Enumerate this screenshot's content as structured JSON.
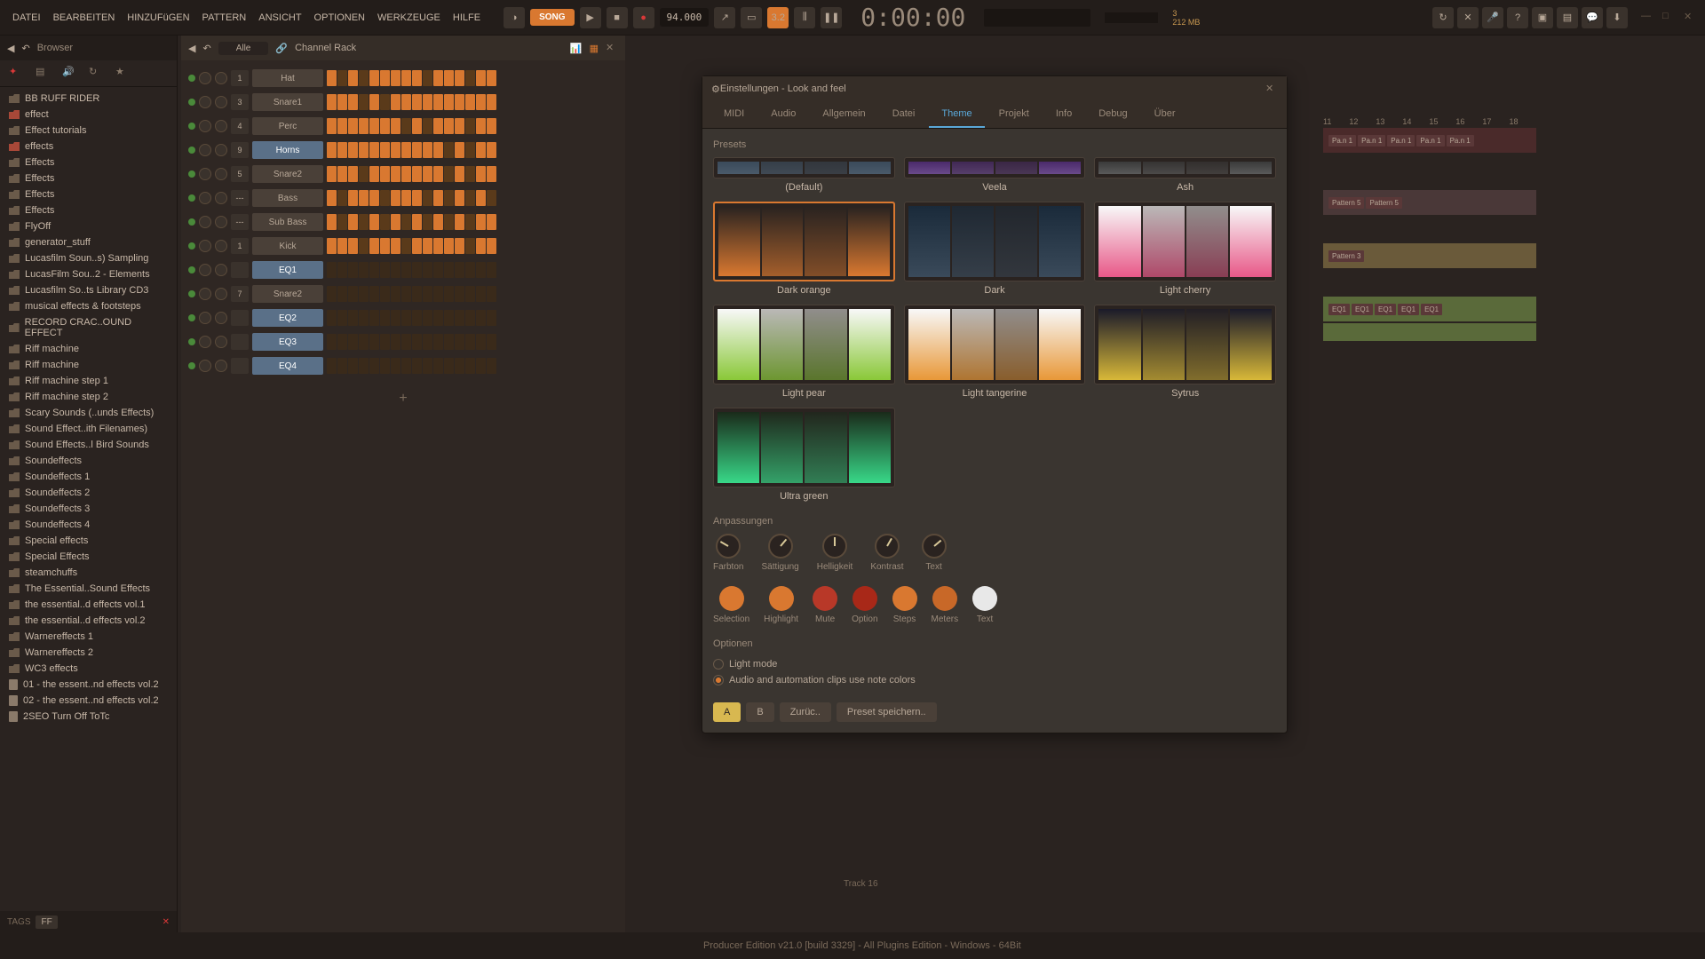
{
  "menubar": {
    "items": [
      "DATEI",
      "BEARBEITEN",
      "HINZUFüGEN",
      "PATTERN",
      "ANSICHT",
      "OPTIONEN",
      "WERKZEUGE",
      "HILFE"
    ]
  },
  "toolbar": {
    "song_label": "SONG",
    "bpm": "94.000",
    "time": "0:00:00",
    "cpu": "3",
    "mem": "212 MB"
  },
  "browser": {
    "title": "Browser",
    "items": [
      {
        "name": "BB RUFF RIDER",
        "type": "folder"
      },
      {
        "name": "effect",
        "type": "folder-red"
      },
      {
        "name": "Effect tutorials",
        "type": "folder"
      },
      {
        "name": "effects",
        "type": "folder-red"
      },
      {
        "name": "Effects",
        "type": "folder"
      },
      {
        "name": "Effects",
        "type": "folder"
      },
      {
        "name": "Effects",
        "type": "folder"
      },
      {
        "name": "Effects",
        "type": "folder"
      },
      {
        "name": "FlyOff",
        "type": "folder"
      },
      {
        "name": "generator_stuff",
        "type": "folder"
      },
      {
        "name": "Lucasfilm Soun..s) Sampling",
        "type": "folder"
      },
      {
        "name": "LucasFilm Sou..2 - Elements",
        "type": "folder"
      },
      {
        "name": "Lucasfilm So..ts Library CD3",
        "type": "folder"
      },
      {
        "name": "musical effects & footsteps",
        "type": "folder"
      },
      {
        "name": "RECORD CRAC..OUND EFFECT",
        "type": "folder"
      },
      {
        "name": "Riff machine",
        "type": "folder"
      },
      {
        "name": "Riff machine",
        "type": "folder"
      },
      {
        "name": "Riff machine step 1",
        "type": "folder"
      },
      {
        "name": "Riff machine step 2",
        "type": "folder"
      },
      {
        "name": "Scary Sounds (..unds Effects)",
        "type": "folder"
      },
      {
        "name": "Sound Effect..ith Filenames)",
        "type": "folder"
      },
      {
        "name": "Sound Effects..l Bird Sounds",
        "type": "folder"
      },
      {
        "name": "Soundeffects",
        "type": "folder"
      },
      {
        "name": "Soundeffects 1",
        "type": "folder"
      },
      {
        "name": "Soundeffects 2",
        "type": "folder"
      },
      {
        "name": "Soundeffects 3",
        "type": "folder"
      },
      {
        "name": "Soundeffects 4",
        "type": "folder"
      },
      {
        "name": "Special effects",
        "type": "folder"
      },
      {
        "name": "Special Effects",
        "type": "folder"
      },
      {
        "name": "steamchuffs",
        "type": "folder"
      },
      {
        "name": "The Essential..Sound Effects",
        "type": "folder"
      },
      {
        "name": "the essential..d effects vol.1",
        "type": "folder"
      },
      {
        "name": "the essential..d effects vol.2",
        "type": "folder"
      },
      {
        "name": "Warnereffects 1",
        "type": "folder"
      },
      {
        "name": "Warnereffects 2",
        "type": "folder"
      },
      {
        "name": "WC3 effects",
        "type": "folder"
      },
      {
        "name": "01 - the essent..nd effects vol.2",
        "type": "file"
      },
      {
        "name": "02 - the essent..nd effects vol.2",
        "type": "file"
      },
      {
        "name": "2SEO Turn Off ToTc",
        "type": "file"
      }
    ],
    "tags_label": "TAGS",
    "tag_ff": "FF"
  },
  "channel_rack": {
    "title": "Channel Rack",
    "filter": "Alle",
    "channels": [
      {
        "num": "1",
        "name": "Hat",
        "selected": false
      },
      {
        "num": "3",
        "name": "Snare1",
        "selected": false
      },
      {
        "num": "4",
        "name": "Perc",
        "selected": false
      },
      {
        "num": "9",
        "name": "Horns",
        "selected": true
      },
      {
        "num": "5",
        "name": "Snare2",
        "selected": false
      },
      {
        "num": "---",
        "name": "Bass",
        "selected": false
      },
      {
        "num": "---",
        "name": "Sub Bass",
        "selected": false
      },
      {
        "num": "1",
        "name": "Kick",
        "selected": false
      },
      {
        "num": "",
        "name": "EQ1",
        "selected": true
      },
      {
        "num": "7",
        "name": "Snare2",
        "selected": false
      },
      {
        "num": "",
        "name": "EQ2",
        "selected": true
      },
      {
        "num": "",
        "name": "EQ3",
        "selected": true
      },
      {
        "num": "",
        "name": "EQ4",
        "selected": true
      }
    ],
    "add_label": "+"
  },
  "settings": {
    "title": "Einstellungen - Look and feel",
    "tabs": [
      "MIDI",
      "Audio",
      "Allgemein",
      "Datei",
      "Theme",
      "Projekt",
      "Info",
      "Debug",
      "Über"
    ],
    "active_tab": "Theme",
    "presets_label": "Presets",
    "presets": [
      {
        "name": "(Default)",
        "small": true
      },
      {
        "name": "Veela",
        "small": true
      },
      {
        "name": "Ash",
        "small": true
      },
      {
        "name": "Dark orange",
        "selected": true
      },
      {
        "name": "Dark"
      },
      {
        "name": "Light cherry"
      },
      {
        "name": "Light pear"
      },
      {
        "name": "Light tangerine"
      },
      {
        "name": "Sytrus"
      },
      {
        "name": "Ultra green"
      }
    ],
    "adjustments_label": "Anpassungen",
    "adjustments": [
      {
        "label": "Farbton"
      },
      {
        "label": "Sättigung"
      },
      {
        "label": "Helligkeit"
      },
      {
        "label": "Kontrast"
      },
      {
        "label": "Text"
      }
    ],
    "swatches": [
      {
        "label": "Selection",
        "color": "#d97830"
      },
      {
        "label": "Highlight",
        "color": "#d97830"
      },
      {
        "label": "Mute",
        "color": "#b83828"
      },
      {
        "label": "Option",
        "color": "#a82818"
      },
      {
        "label": "Steps",
        "color": "#d97830"
      },
      {
        "label": "Meters",
        "color": "#c86828"
      },
      {
        "label": "Text",
        "color": "#e8e8e8"
      }
    ],
    "options_label": "Optionen",
    "option_light": "Light mode",
    "option_clips": "Audio and automation clips use note colors",
    "footer_a": "A",
    "footer_b": "B",
    "footer_reset": "Zurüc..",
    "footer_save": "Preset speichern.."
  },
  "patterns": [
    "Patt",
    "Patt",
    "Patt",
    "Patt",
    "Patt",
    "Patt"
  ],
  "playlist": {
    "ruler": [
      "11",
      "12",
      "13",
      "14",
      "15",
      "16",
      "17",
      "18"
    ],
    "clips_row1": [
      "Pa.n 1",
      "Pa.n 1",
      "Pa.n 1",
      "Pa.n 1",
      "Pa.n 1"
    ],
    "clips_row2": [
      "Pattern 5",
      "Pattern 5"
    ],
    "clips_row3": [
      "Pattern 3"
    ],
    "clips_row4": [
      "EQ1",
      "EQ1",
      "EQ1",
      "EQ1",
      "EQ1"
    ],
    "track16": "Track 16"
  },
  "statusbar": {
    "text": "Producer Edition v21.0 [build 3329] - All Plugins Edition - Windows - 64Bit"
  }
}
